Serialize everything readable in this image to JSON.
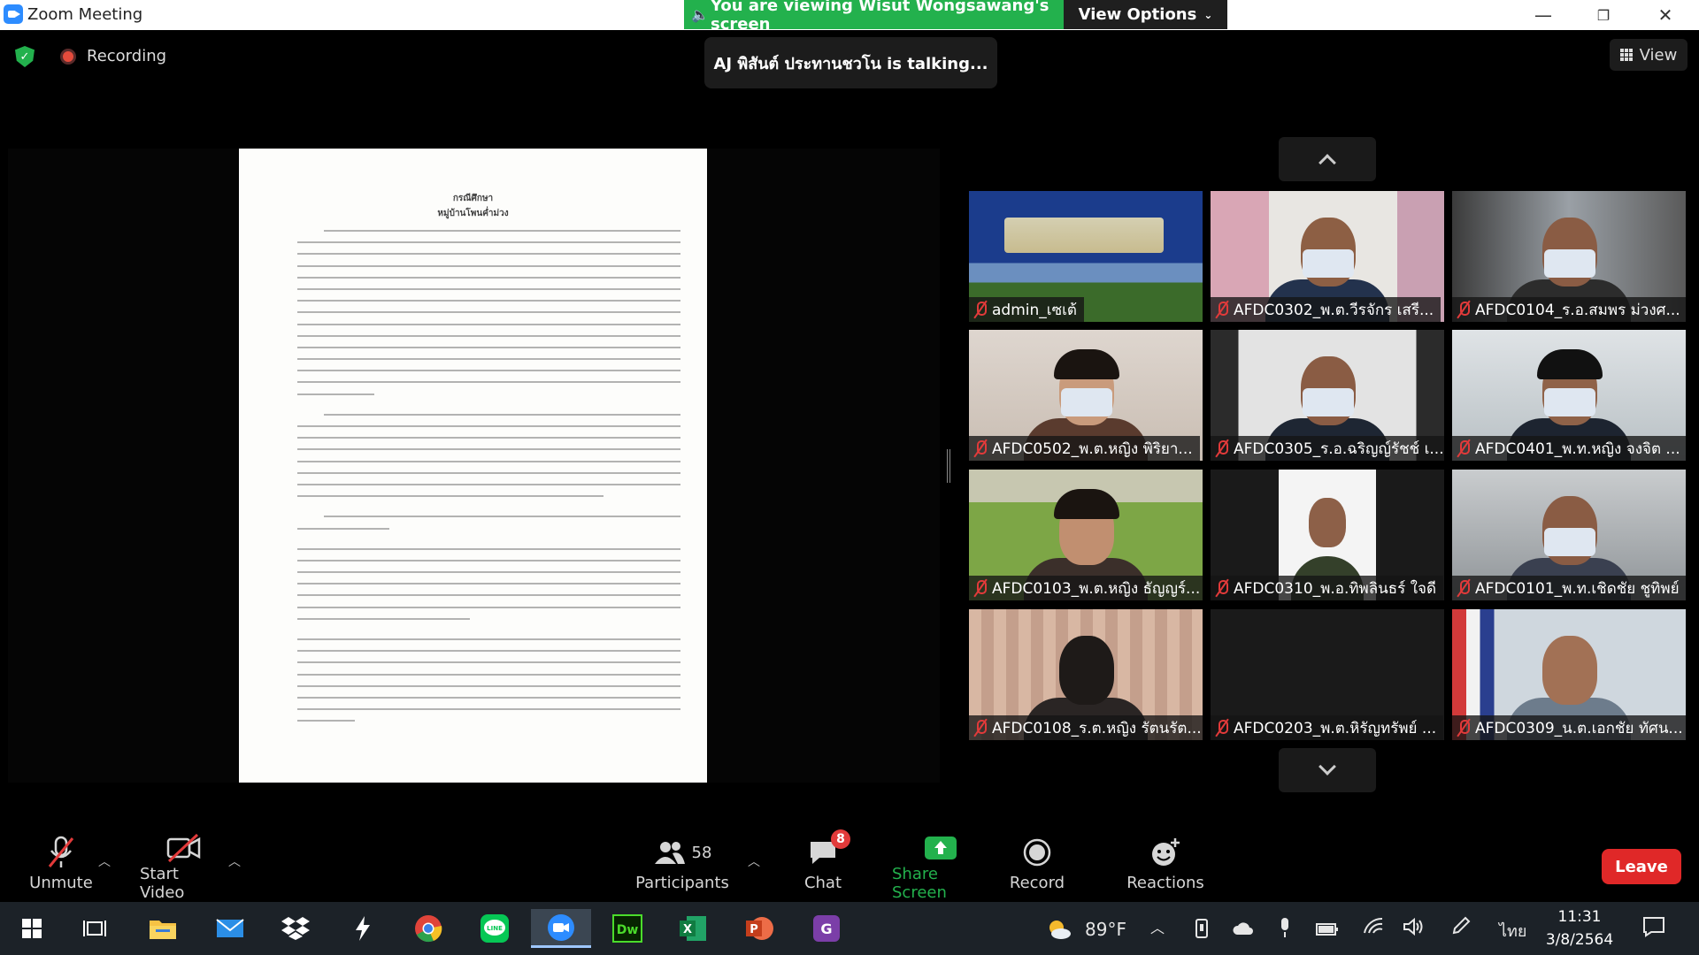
{
  "window": {
    "title": "Zoom Meeting",
    "minimize": "—",
    "maximize": "❐",
    "close": "✕"
  },
  "share_banner": {
    "text": "You are viewing Wisut Wongsawang's screen",
    "view_options": "View Options"
  },
  "topbar": {
    "recording": "Recording",
    "talking": "AJ พิสันต์ ประทานชวโน is talking...",
    "view": "View"
  },
  "document": {
    "title_line1": "กรณีศึกษา",
    "title_line2": "หมู่บ้านโพนค่ำม่วง"
  },
  "gallery": {
    "participants": [
      {
        "name": "admin_เซเต้",
        "muted": true
      },
      {
        "name": "AFDC0302_พ.ต.วีรจักร เสรี...",
        "muted": true
      },
      {
        "name": "AFDC0104_ร.อ.สมพร ม่วงศ...",
        "muted": true
      },
      {
        "name": "AFDC0502_พ.ต.หญิง พิริยา...",
        "muted": true
      },
      {
        "name": "AFDC0305_ร.อ.ฉริญญ์รัชช์ เ...",
        "muted": true
      },
      {
        "name": "AFDC0401_พ.ท.หญิง จงจิต ...",
        "muted": true
      },
      {
        "name": "AFDC0103_พ.ต.หญิง ธัญญร์...",
        "muted": true
      },
      {
        "name": "AFDC0310_พ.อ.ทิพลินธร์ ใจดี",
        "muted": true
      },
      {
        "name": "AFDC0101_พ.ท.เชิดชัย ชูทิพย์",
        "muted": true
      },
      {
        "name": "AFDC0108_ร.ต.หญิง รัตนรัต...",
        "muted": true
      },
      {
        "name": "AFDC0203_พ.ต.หิรัญทรัพย์ ...",
        "muted": true
      },
      {
        "name": "AFDC0309_น.ต.เอกชัย ทัศน...",
        "muted": true
      }
    ]
  },
  "toolbar": {
    "unmute": "Unmute",
    "start_video": "Start Video",
    "participants_label": "Participants",
    "participants_count": "58",
    "chat": "Chat",
    "chat_badge": "8",
    "share_screen": "Share Screen",
    "record": "Record",
    "reactions": "Reactions",
    "leave": "Leave"
  },
  "taskbar": {
    "weather": "89°F",
    "language": "ไทย",
    "time": "11:31",
    "date": "3/8/2564"
  },
  "colors": {
    "banner_green": "#23b14d",
    "leave_red": "#e02828",
    "zoom_blue": "#2d8cff",
    "share_green": "#23b14d"
  }
}
